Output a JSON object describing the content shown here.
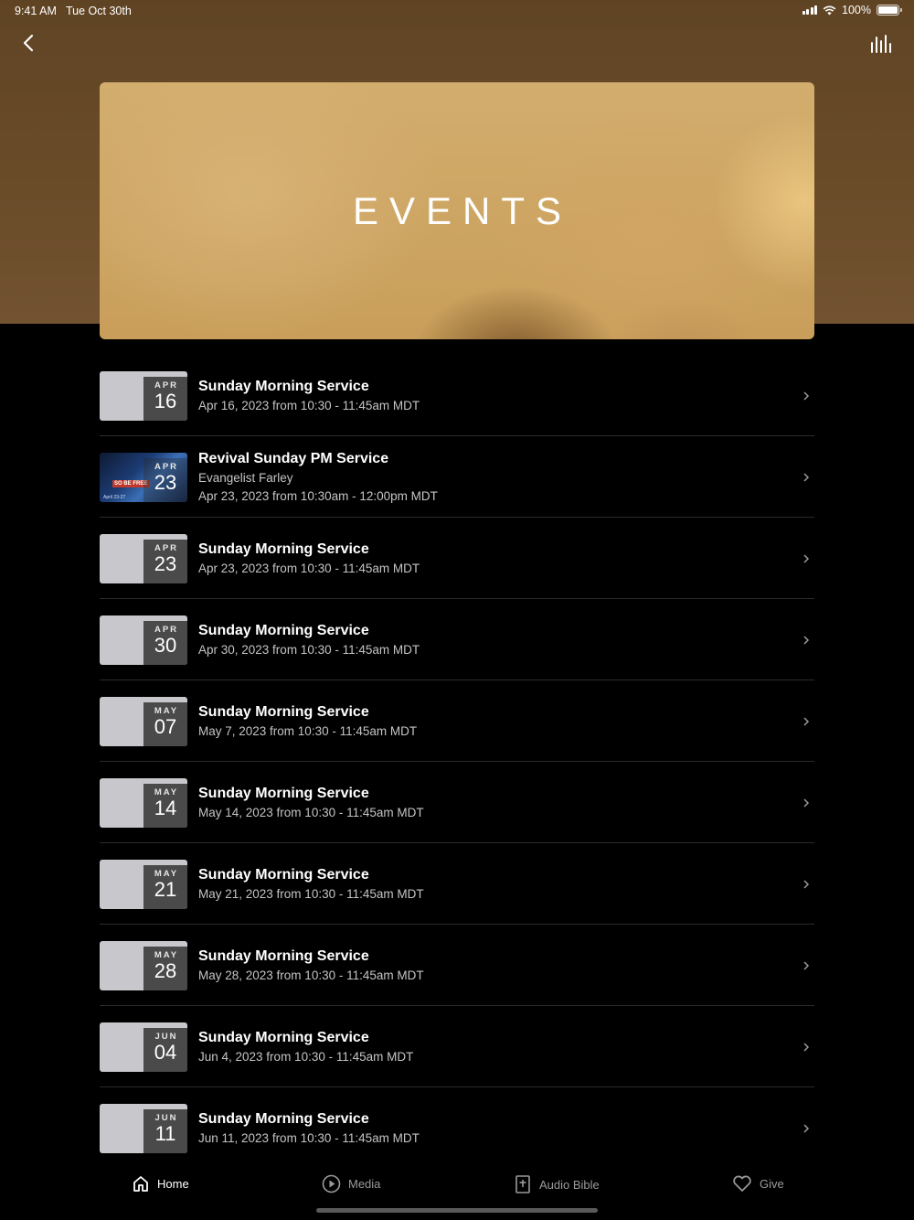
{
  "status_bar": {
    "time": "9:41 AM",
    "date": "Tue Oct 30th",
    "battery": "100%"
  },
  "hero": {
    "title": "EVENTS"
  },
  "events": [
    {
      "month": "APR",
      "day": "16",
      "title": "Sunday Morning Service",
      "line1": "Apr 16, 2023 from 10:30 - 11:45am MDT"
    },
    {
      "month": "APR",
      "day": "23",
      "title": "Revival Sunday PM Service",
      "line1": "Evangelist Farley",
      "line2": "Apr 23, 2023 from 10:30am - 12:00pm MDT",
      "flyer_text": "SO BE FREE",
      "flyer_sub": "April 23-27"
    },
    {
      "month": "APR",
      "day": "23",
      "title": "Sunday Morning Service",
      "line1": "Apr 23, 2023 from 10:30 - 11:45am MDT"
    },
    {
      "month": "APR",
      "day": "30",
      "title": "Sunday Morning Service",
      "line1": "Apr 30, 2023 from 10:30 - 11:45am MDT"
    },
    {
      "month": "MAY",
      "day": "07",
      "title": "Sunday Morning Service",
      "line1": "May 7, 2023 from 10:30 - 11:45am MDT"
    },
    {
      "month": "MAY",
      "day": "14",
      "title": "Sunday Morning Service",
      "line1": "May 14, 2023 from 10:30 - 11:45am MDT"
    },
    {
      "month": "MAY",
      "day": "21",
      "title": "Sunday Morning Service",
      "line1": "May 21, 2023 from 10:30 - 11:45am MDT"
    },
    {
      "month": "MAY",
      "day": "28",
      "title": "Sunday Morning Service",
      "line1": "May 28, 2023 from 10:30 - 11:45am MDT"
    },
    {
      "month": "JUN",
      "day": "04",
      "title": "Sunday Morning Service",
      "line1": "Jun 4, 2023 from 10:30 - 11:45am MDT"
    },
    {
      "month": "JUN",
      "day": "11",
      "title": "Sunday Morning Service",
      "line1": "Jun 11, 2023 from 10:30 - 11:45am MDT"
    }
  ],
  "tabs": [
    {
      "label": "Home",
      "icon": "home-icon",
      "active": true
    },
    {
      "label": "Media",
      "icon": "play-circle-icon",
      "active": false
    },
    {
      "label": "Audio Bible",
      "icon": "bible-icon",
      "active": false
    },
    {
      "label": "Give",
      "icon": "heart-icon",
      "active": false
    }
  ],
  "colors": {
    "header_brown": "#6b4c29",
    "background": "#000000",
    "badge": "#4a4a4a"
  }
}
